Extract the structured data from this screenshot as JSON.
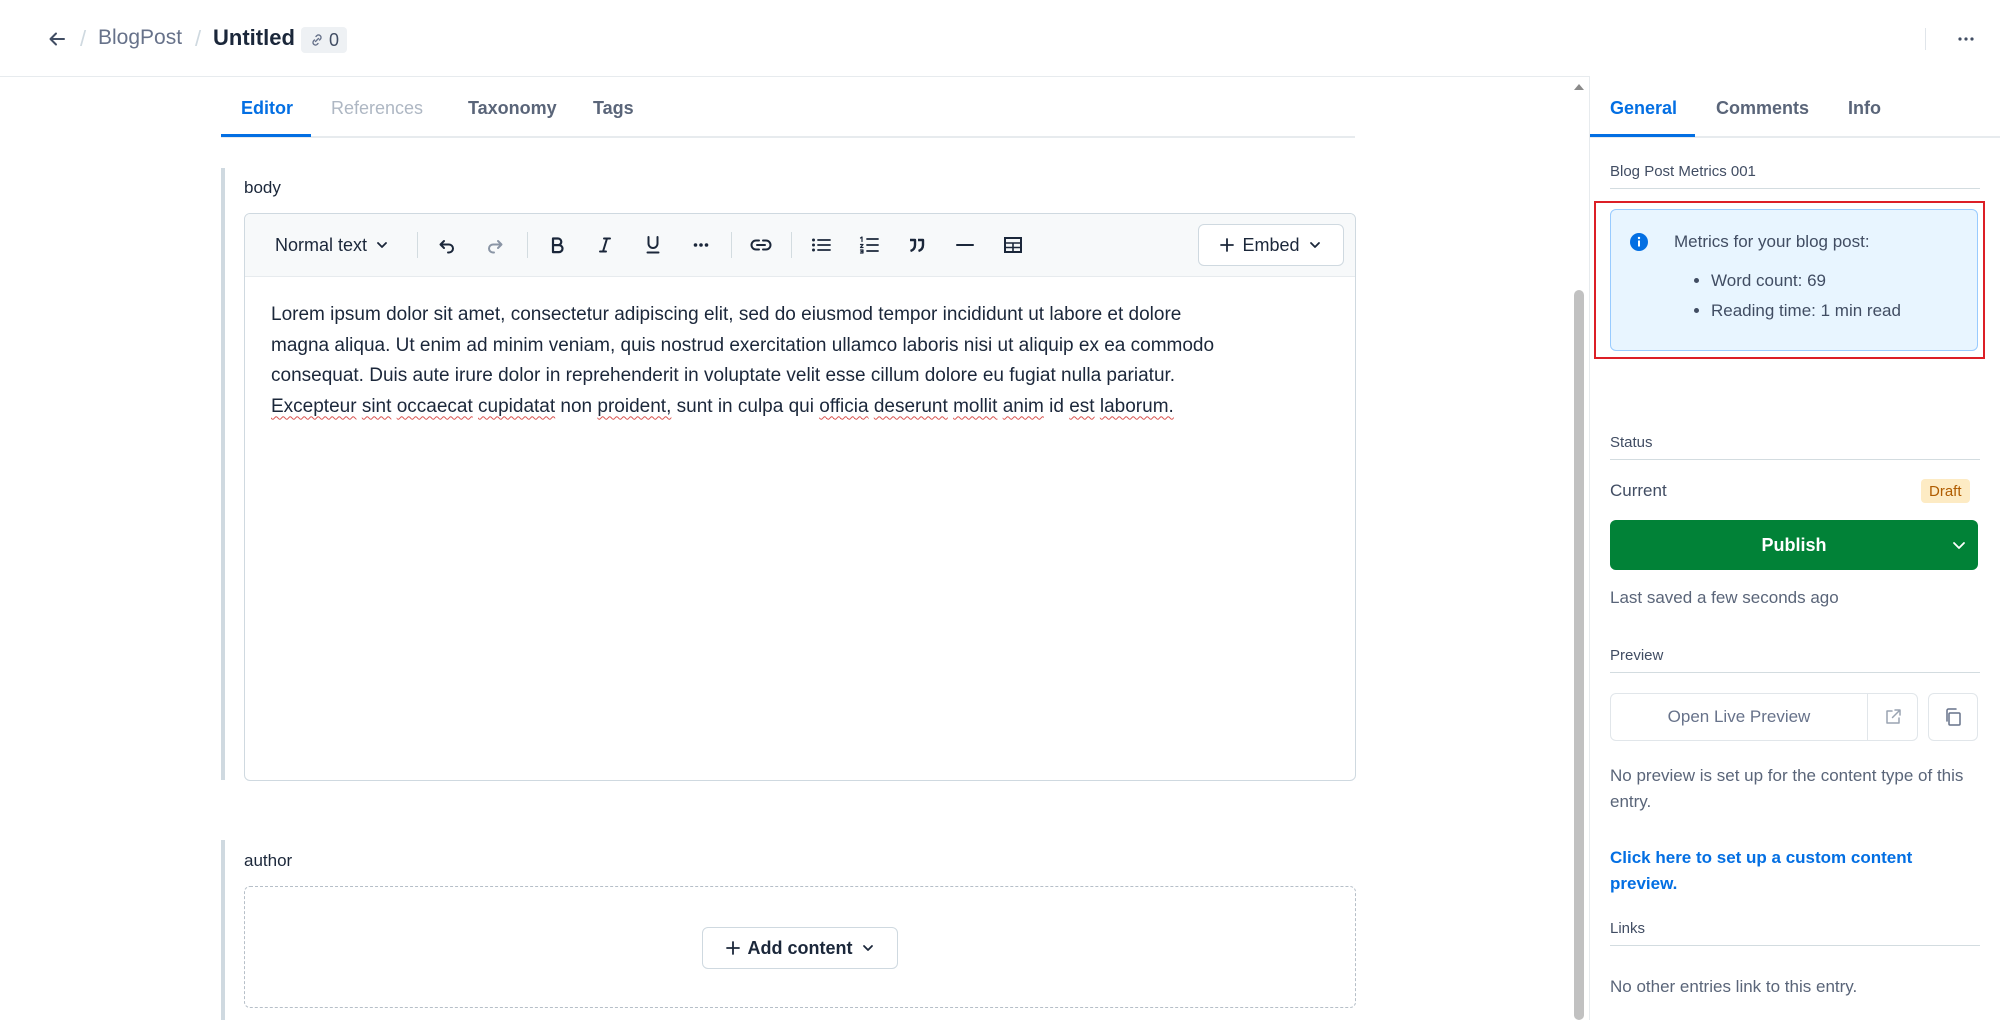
{
  "header": {
    "breadcrumb_parent": "BlogPost",
    "breadcrumb_sep": "/",
    "entry_title": "Untitled",
    "references_count": "0",
    "icons": [
      "arrow-left-icon",
      "link-icon",
      "more-horizontal-icon"
    ]
  },
  "editor_tabs": [
    {
      "label": "Editor",
      "state": "active"
    },
    {
      "label": "References",
      "state": "disabled"
    },
    {
      "label": "Taxonomy",
      "state": "normal"
    },
    {
      "label": "Tags",
      "state": "normal"
    }
  ],
  "fields": {
    "body": {
      "label": "body",
      "toolbar": {
        "text_style": "Normal text",
        "embed_label": "Embed",
        "icons": [
          "undo-icon",
          "redo-icon",
          "bold-icon",
          "italic-icon",
          "underline-icon",
          "more-icon",
          "link-icon",
          "bulleted-list-icon",
          "numbered-list-icon",
          "quote-icon",
          "horizontal-rule-icon",
          "table-icon"
        ]
      },
      "content": {
        "line1": "Lorem ipsum dolor sit amet, consectetur adipiscing elit, sed do eiusmod tempor incididunt ut labore et dolore",
        "line2": "magna aliqua. Ut enim ad minim veniam, quis nostrud exercitation ullamco laboris nisi ut aliquip ex ea commodo",
        "line3": "consequat. Duis aute irure dolor in reprehenderit in voluptate velit esse cillum dolore eu fugiat nulla pariatur.",
        "line4_words": [
          "Excepteur",
          "sint",
          "occaecat",
          "cupidatat",
          "non",
          "proident,",
          "sunt in culpa qui",
          "officia",
          "deserunt",
          "mollit",
          "anim",
          "id",
          "est",
          "laborum."
        ]
      }
    },
    "author": {
      "label": "author",
      "add_content_label": "Add content"
    }
  },
  "sidebar": {
    "tabs": [
      {
        "label": "General",
        "state": "active"
      },
      {
        "label": "Comments",
        "state": "normal"
      },
      {
        "label": "Info",
        "state": "normal"
      }
    ],
    "metrics": {
      "heading": "Blog Post Metrics 001",
      "note_title": "Metrics for your blog post:",
      "items": [
        "Word count: 69",
        "Reading time: 1 min read"
      ],
      "highlight_color": "#dc1f26"
    },
    "status": {
      "heading": "Status",
      "current_label": "Current",
      "badge": "Draft",
      "publish_label": "Publish",
      "last_saved": "Last saved a few seconds ago",
      "publish_color": "#018237"
    },
    "preview": {
      "heading": "Preview",
      "open_label": "Open Live Preview",
      "no_preview_text": "No preview is set up for the content type of this entry.",
      "setup_link": "Click here to set up a custom content preview."
    },
    "links": {
      "heading": "Links",
      "empty_text": "No other entries link to this entry."
    }
  },
  "colors": {
    "accent": "#036fe3",
    "text": "#1b273a",
    "muted": "#5a6579",
    "draft_badge_bg": "#fdebc4",
    "info_bg": "#e8f5ff"
  }
}
